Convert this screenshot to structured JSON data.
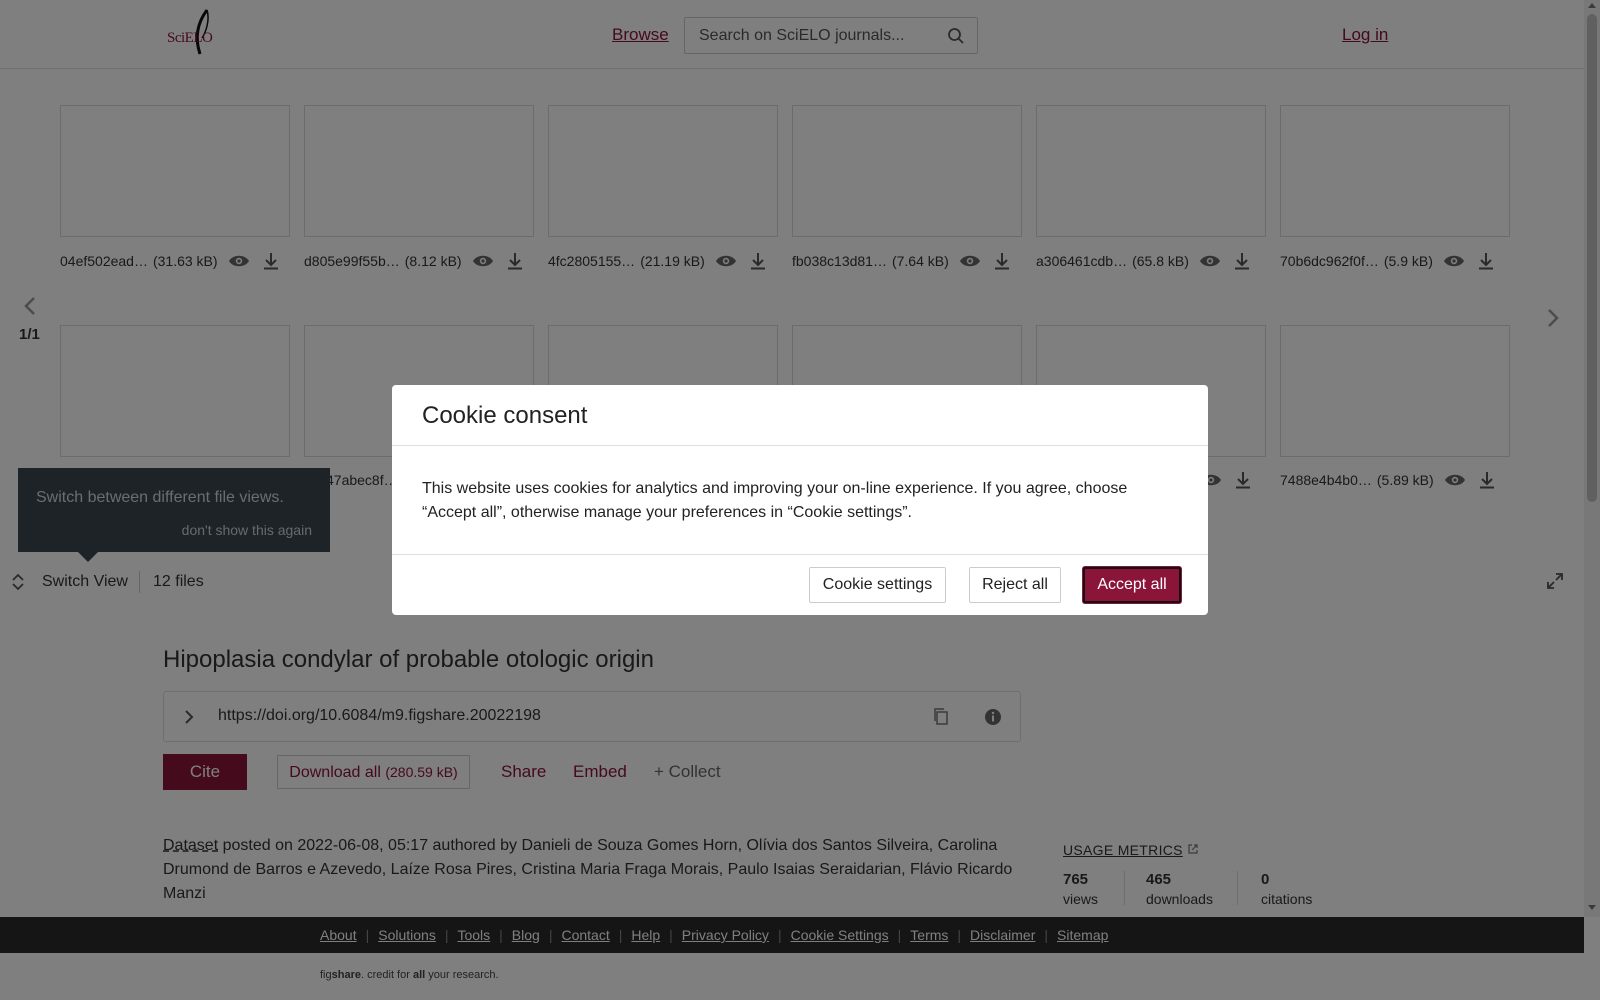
{
  "header": {
    "logo_text": "SciELO",
    "browse_label": "Browse",
    "search_placeholder": "Search on SciELO journals...",
    "login_label": "Log in"
  },
  "files_row1": [
    {
      "name": "04ef502ead…",
      "size": "(31.63 kB)"
    },
    {
      "name": "d805e99f55b…",
      "size": "(8.12 kB)"
    },
    {
      "name": "4fc2805155…",
      "size": "(21.19 kB)"
    },
    {
      "name": "fb038c13d81…",
      "size": "(7.64 kB)"
    },
    {
      "name": "a306461cdb…",
      "size": "(65.8 kB)"
    },
    {
      "name": "70b6dc962f0f…",
      "size": "(5.9 kB)"
    }
  ],
  "files_row2": {
    "partial_name": "47abec8f…",
    "last": {
      "name": "7488e4b4b0…",
      "size": "(5.89 kB)"
    }
  },
  "pager": "1/1",
  "tooltip": {
    "message": "Switch between different file views.",
    "dismiss": "don't show this again"
  },
  "switchbar": {
    "switch_label": "Switch View",
    "file_count": "12 files"
  },
  "article": {
    "title": "Hipoplasia condylar of probable otologic origin",
    "doi": "https://doi.org/10.6084/m9.figshare.20022198",
    "cite_label": "Cite",
    "download_label": "Download all",
    "download_size": "(280.59 kB)",
    "share_label": "Share",
    "embed_label": "Embed",
    "collect_label": "+ Collect",
    "type": "Dataset",
    "meta_text": " posted on 2022-06-08, 05:17 authored by Danieli de Souza Gomes Horn, Olívia dos Santos Silveira, Carolina Drumond de Barros e Azevedo, Laíze Rosa Pires, Cristina Maria Fraga Morais, Paulo Isaias Seraidarian, Flávio Ricardo Manzi"
  },
  "metrics": {
    "title": "USAGE METRICS",
    "views": "765",
    "views_label": "views",
    "downloads": "465",
    "downloads_label": "downloads",
    "citations": "0",
    "citations_label": "citations"
  },
  "footer": {
    "links": [
      "About",
      "Solutions",
      "Tools",
      "Blog",
      "Contact",
      "Help",
      "Privacy Policy",
      "Cookie Settings",
      "Terms",
      "Disclaimer",
      "Sitemap"
    ],
    "credit_pre": "fig",
    "credit_brand": "share",
    "credit_mid": ". credit for ",
    "credit_all": "all",
    "credit_post": " your research."
  },
  "modal": {
    "title": "Cookie consent",
    "body": "This website uses cookies for analytics and improving your on-line experience. If you agree, choose “Accept all”, otherwise manage your preferences in “Cookie settings”.",
    "settings_label": "Cookie settings",
    "reject_label": "Reject all",
    "accept_label": "Accept all"
  },
  "colors": {
    "brand": "#8a1538",
    "footer_bg": "#2b2b2b",
    "tooltip_bg": "#3c4650"
  }
}
